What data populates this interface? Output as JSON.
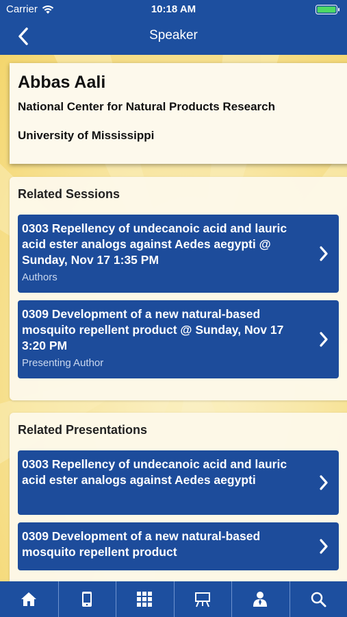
{
  "status": {
    "carrier": "Carrier",
    "time": "10:18 AM"
  },
  "nav": {
    "title": "Speaker",
    "back_icon": "chevron-left-icon"
  },
  "speaker": {
    "name": "Abbas Aali",
    "affiliation": "National Center for Natural Products Research",
    "university": "University of Mississippi"
  },
  "related_sessions": {
    "title": "Related Sessions",
    "items": [
      {
        "title": "0303 Repellency of undecanoic acid and lauric acid ester analogs against Aedes aegypti @ Sunday, Nov 17 1:35 PM",
        "role": "Authors"
      },
      {
        "title": "0309 Development of a new natural-based mosquito repellent product @ Sunday, Nov 17 3:20 PM",
        "role": "Presenting Author"
      }
    ]
  },
  "related_presentations": {
    "title": "Related Presentations",
    "items": [
      {
        "title": "0303 Repellency of undecanoic acid and lauric acid ester analogs against Aedes aegypti"
      },
      {
        "title": "0309 Development of a new natural-based mosquito repellent product"
      }
    ]
  },
  "tabbar": {
    "icons": [
      "home-icon",
      "mobile-device-icon",
      "grid-icon",
      "presentation-board-icon",
      "speaker-person-icon",
      "search-icon"
    ]
  },
  "colors": {
    "brand_blue": "#1d4f9f",
    "item_blue": "#1d4c9b",
    "background_yellow": "#f4d66d"
  }
}
